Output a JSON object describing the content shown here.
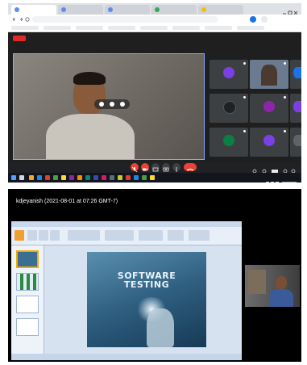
{
  "top_screenshot": {
    "browser": {
      "tabs": [
        "",
        "",
        "",
        "",
        ""
      ],
      "url": "",
      "bookmarks": [
        "",
        "",
        "",
        "",
        "",
        "",
        "",
        ""
      ]
    },
    "meet": {
      "rec_label": "",
      "participants": [
        {
          "initial": "",
          "name": "",
          "color": "#7b3fe4"
        },
        {
          "initial": "",
          "name": "",
          "color": "#5f6368"
        },
        {
          "initial": "",
          "name": "",
          "color": "#1a73e8"
        },
        {
          "initial": "",
          "name": "",
          "color": "#202124"
        },
        {
          "initial": "",
          "name": "",
          "color": "#8e24aa"
        },
        {
          "initial": "",
          "name": "",
          "color": "#7b3fe4"
        },
        {
          "initial": "",
          "name": "",
          "color": "#0b8043"
        },
        {
          "initial": "",
          "name": "",
          "color": "#7b3fe4"
        },
        {
          "initial": "",
          "name": "",
          "color": "#5f6368"
        }
      ],
      "meeting_code": "",
      "controls": [
        "mic",
        "camera",
        "captions",
        "present",
        "more",
        "leave"
      ],
      "colors": {
        "leave": "#ea4335",
        "mic_off": "#ea4335",
        "accent": "#8ab4f8"
      }
    }
  },
  "bottom_screenshot": {
    "presenter_label": "kdjeyanish (2021-08-01 at 07:26 GMT-7)",
    "slide": {
      "title_line1": "SOFTWARE",
      "title_line2": "TESTING"
    },
    "self_view_name": ""
  }
}
